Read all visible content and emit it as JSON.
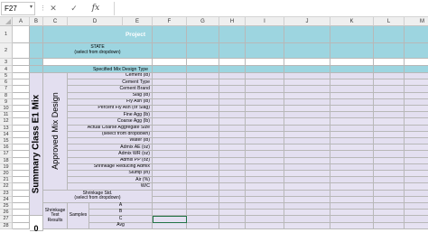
{
  "name_box": {
    "value": "F27"
  },
  "formula_bar": {
    "cancel_icon": "✕",
    "enter_icon": "✓",
    "fx_label": "fx",
    "value": ""
  },
  "columns": [
    "A",
    "B",
    "C",
    "D",
    "E",
    "F",
    "G",
    "H",
    "I",
    "J",
    "K",
    "L",
    "M"
  ],
  "rows": [
    "1",
    "2",
    "3",
    "4",
    "5",
    "6",
    "7",
    "8",
    "9",
    "10",
    "11",
    "12",
    "13",
    "14",
    "15",
    "16",
    "17",
    "18",
    "19",
    "20",
    "21",
    "22",
    "23",
    "24",
    "25",
    "26",
    "27",
    "28"
  ],
  "sheet": {
    "project": "Project",
    "state_line1": "STATE",
    "state_line2": "(select from dropdown)",
    "mix_type": "Specified Mix Design Type",
    "summary": "Summary Class E1 Mix",
    "approved": "Approved Mix Design",
    "labels": [
      "Cement (lb)",
      "Cement Type",
      "Cement Brand",
      "Slag (lb)",
      "Fly Ash (lb)",
      "Percent Fly Ash (or Slag)",
      "Fine Agg (lb)",
      "Coarse Agg (lb)",
      "Actual Coarse Aggregate Size",
      "(select from dropdown)",
      "Water (lb)",
      "Admix AE (oz)",
      "Admix WR (oz)",
      "Admix PP (oz)",
      "Shrinkage Reducing Admix",
      "Slump (in)",
      "Air (%)",
      "W/C",
      "Unit Weight (pcf)"
    ],
    "shrink_std_line1": "Shrinkage Std.",
    "shrink_std_line2": "(select from dropdown)",
    "shrink_results_line1": "Shrinkage",
    "shrink_results_line2": "Test Results",
    "samples": "Samples",
    "sample_labels": [
      "A",
      "B",
      "C",
      "Avg"
    ],
    "bottom_digit": "0"
  }
}
